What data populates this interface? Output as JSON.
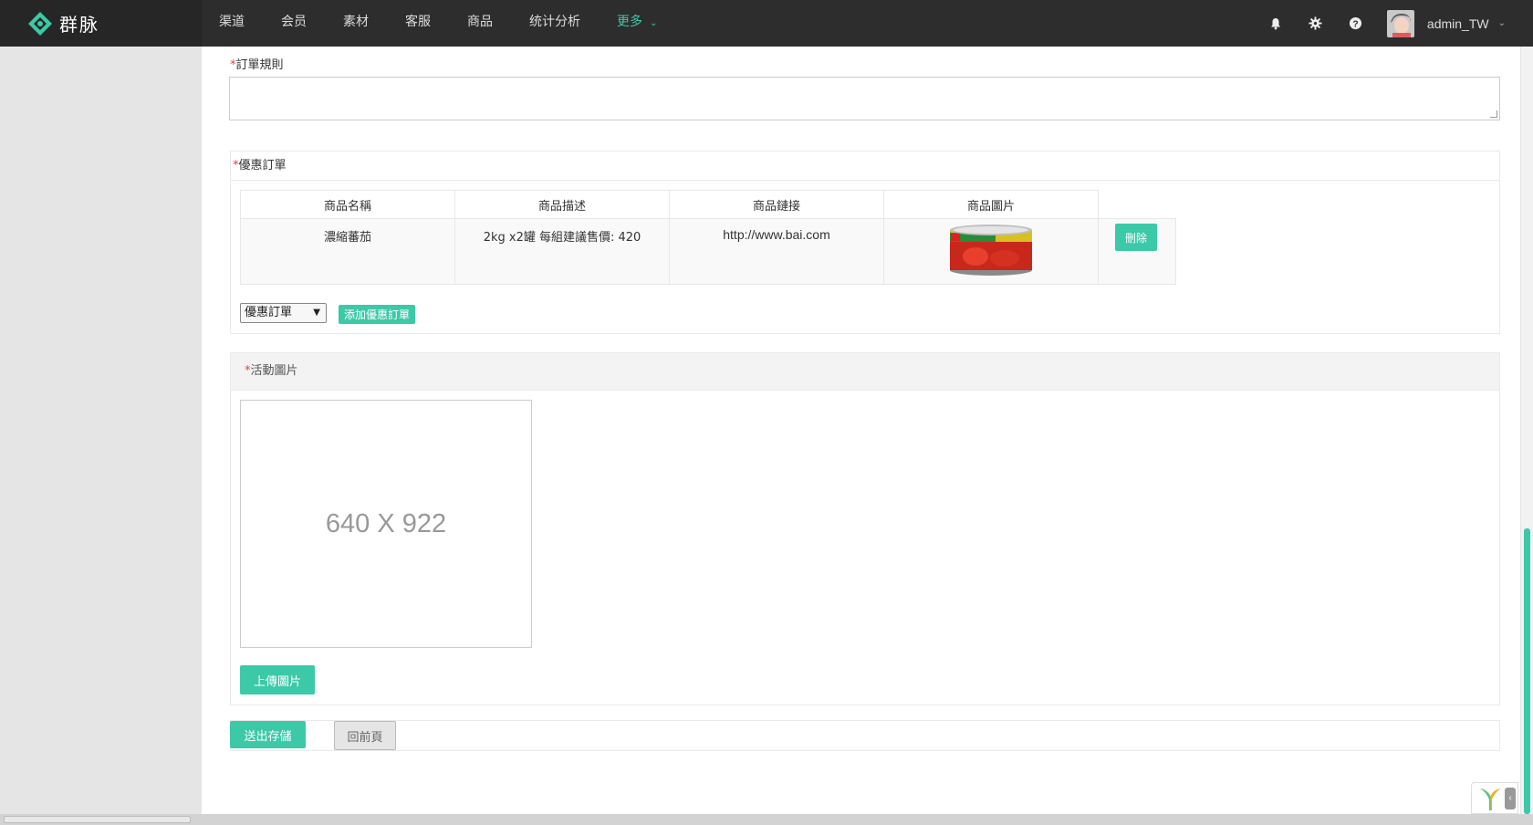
{
  "brand": {
    "name": "群脉"
  },
  "nav": {
    "items": [
      {
        "label": "渠道"
      },
      {
        "label": "会员"
      },
      {
        "label": "素材"
      },
      {
        "label": "客服"
      },
      {
        "label": "商品"
      },
      {
        "label": "统计分析"
      },
      {
        "label": "更多",
        "active": true
      }
    ]
  },
  "user": {
    "name": "admin_TW"
  },
  "colors": {
    "accent": "#3cc9a8",
    "topbar": "#2d2d2d",
    "required": "#e0463b"
  },
  "form": {
    "required_mark": "*",
    "order_rule": {
      "label": "訂單規則",
      "value": ""
    },
    "discount_order": {
      "label": "優惠訂單",
      "table": {
        "headers": [
          "商品名稱",
          "商品描述",
          "商品鏈接",
          "商品圖片"
        ],
        "rows": [
          {
            "name": "濃縮蕃茄",
            "desc": "2kg x2罐 每組建議售價: 420",
            "link": "http://www.bai.com",
            "image_alt": "tomato-paste-can"
          }
        ],
        "delete_label": "刪除"
      },
      "select_value": "優惠訂單",
      "add_label": "添加優惠訂單"
    },
    "activity_image": {
      "label": "活動圖片",
      "placeholder": "640 X 922",
      "upload_label": "上傳圖片"
    },
    "submit_label": "送出存儲",
    "back_label": "回前頁"
  }
}
